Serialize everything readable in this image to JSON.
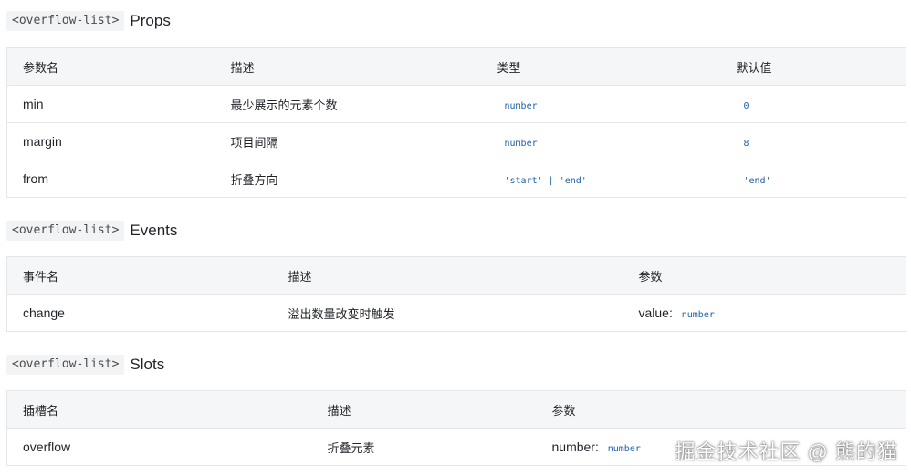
{
  "props": {
    "tag": "<overflow-list>",
    "title": "Props",
    "headers": [
      "参数名",
      "描述",
      "类型",
      "默认值"
    ],
    "rows": [
      {
        "name": "min",
        "desc": "最少展示的元素个数",
        "type": "number",
        "default": "0"
      },
      {
        "name": "margin",
        "desc": "项目间隔",
        "type": "number",
        "default": "8"
      },
      {
        "name": "from",
        "desc": "折叠方向",
        "type": "'start' | 'end'",
        "default": "'end'"
      }
    ]
  },
  "events": {
    "tag": "<overflow-list>",
    "title": "Events",
    "headers": [
      "事件名",
      "描述",
      "参数"
    ],
    "rows": [
      {
        "name": "change",
        "desc": "溢出数量改变时触发",
        "param_label": "value:",
        "param_type": "number"
      }
    ]
  },
  "slots": {
    "tag": "<overflow-list>",
    "title": "Slots",
    "headers": [
      "插槽名",
      "描述",
      "参数"
    ],
    "rows": [
      {
        "name": "overflow",
        "desc": "折叠元素",
        "param_label": "number:",
        "param_type": "number"
      }
    ]
  },
  "watermark": "掘金技术社区 @ 熊的猫"
}
